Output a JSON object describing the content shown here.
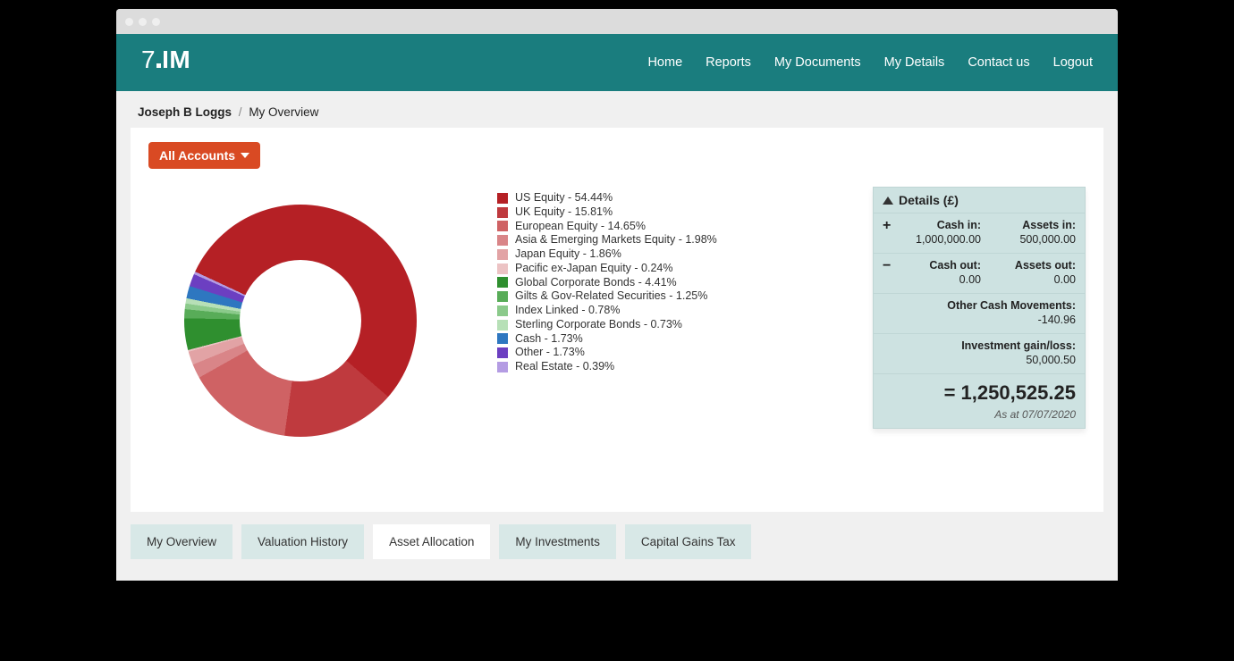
{
  "header": {
    "logo_text": "7IM",
    "nav": [
      "Home",
      "Reports",
      "My Documents",
      "My Details",
      "Contact us",
      "Logout"
    ]
  },
  "breadcrumb": {
    "user": "Joseph B Loggs",
    "page": "My Overview"
  },
  "accounts_button_label": "All Accounts",
  "details": {
    "title": "Details (£)",
    "rows": [
      {
        "sign": "+",
        "left_label": "Cash in:",
        "left_value": "1,000,000.00",
        "right_label": "Assets in:",
        "right_value": "500,000.00"
      },
      {
        "sign": "−",
        "left_label": "Cash out:",
        "left_value": "0.00",
        "right_label": "Assets out:",
        "right_value": "0.00"
      }
    ],
    "singles": [
      {
        "label": "Other Cash Movements:",
        "value": "-140.96"
      },
      {
        "label": "Investment gain/loss:",
        "value": "50,000.50"
      }
    ],
    "total_prefix": "= ",
    "total": "1,250,525.25",
    "as_at_prefix": "As at ",
    "as_at": "07/07/2020"
  },
  "tabs": [
    {
      "label": "My Overview",
      "active": false
    },
    {
      "label": "Valuation History",
      "active": false
    },
    {
      "label": "Asset Allocation",
      "active": true
    },
    {
      "label": "My Investments",
      "active": false
    },
    {
      "label": "Capital Gains Tax",
      "active": false
    }
  ],
  "chart_data": {
    "type": "pie",
    "title": "Asset Allocation",
    "series": [
      {
        "name": "US Equity",
        "value": 54.44,
        "color": "#b52025"
      },
      {
        "name": "UK Equity",
        "value": 15.81,
        "color": "#bf3a3e"
      },
      {
        "name": "European Equity",
        "value": 14.65,
        "color": "#cf6264"
      },
      {
        "name": "Asia & Emerging Markets Equity",
        "value": 1.98,
        "color": "#d98588"
      },
      {
        "name": "Japan Equity",
        "value": 1.86,
        "color": "#e2a3a5"
      },
      {
        "name": "Pacific ex-Japan Equity",
        "value": 0.24,
        "color": "#ecc3c4"
      },
      {
        "name": "Global Corporate Bonds",
        "value": 4.41,
        "color": "#2f8f2f"
      },
      {
        "name": "Gilts & Gov-Related Securities",
        "value": 1.25,
        "color": "#58ac58"
      },
      {
        "name": "Index Linked",
        "value": 0.78,
        "color": "#8bca8b"
      },
      {
        "name": "Sterling Corporate Bonds",
        "value": 0.73,
        "color": "#b7e0b7"
      },
      {
        "name": "Cash",
        "value": 1.73,
        "color": "#2e77c0"
      },
      {
        "name": "Other",
        "value": 1.73,
        "color": "#6c3fc1"
      },
      {
        "name": "Real Estate",
        "value": 0.39,
        "color": "#b49ce3"
      }
    ]
  }
}
